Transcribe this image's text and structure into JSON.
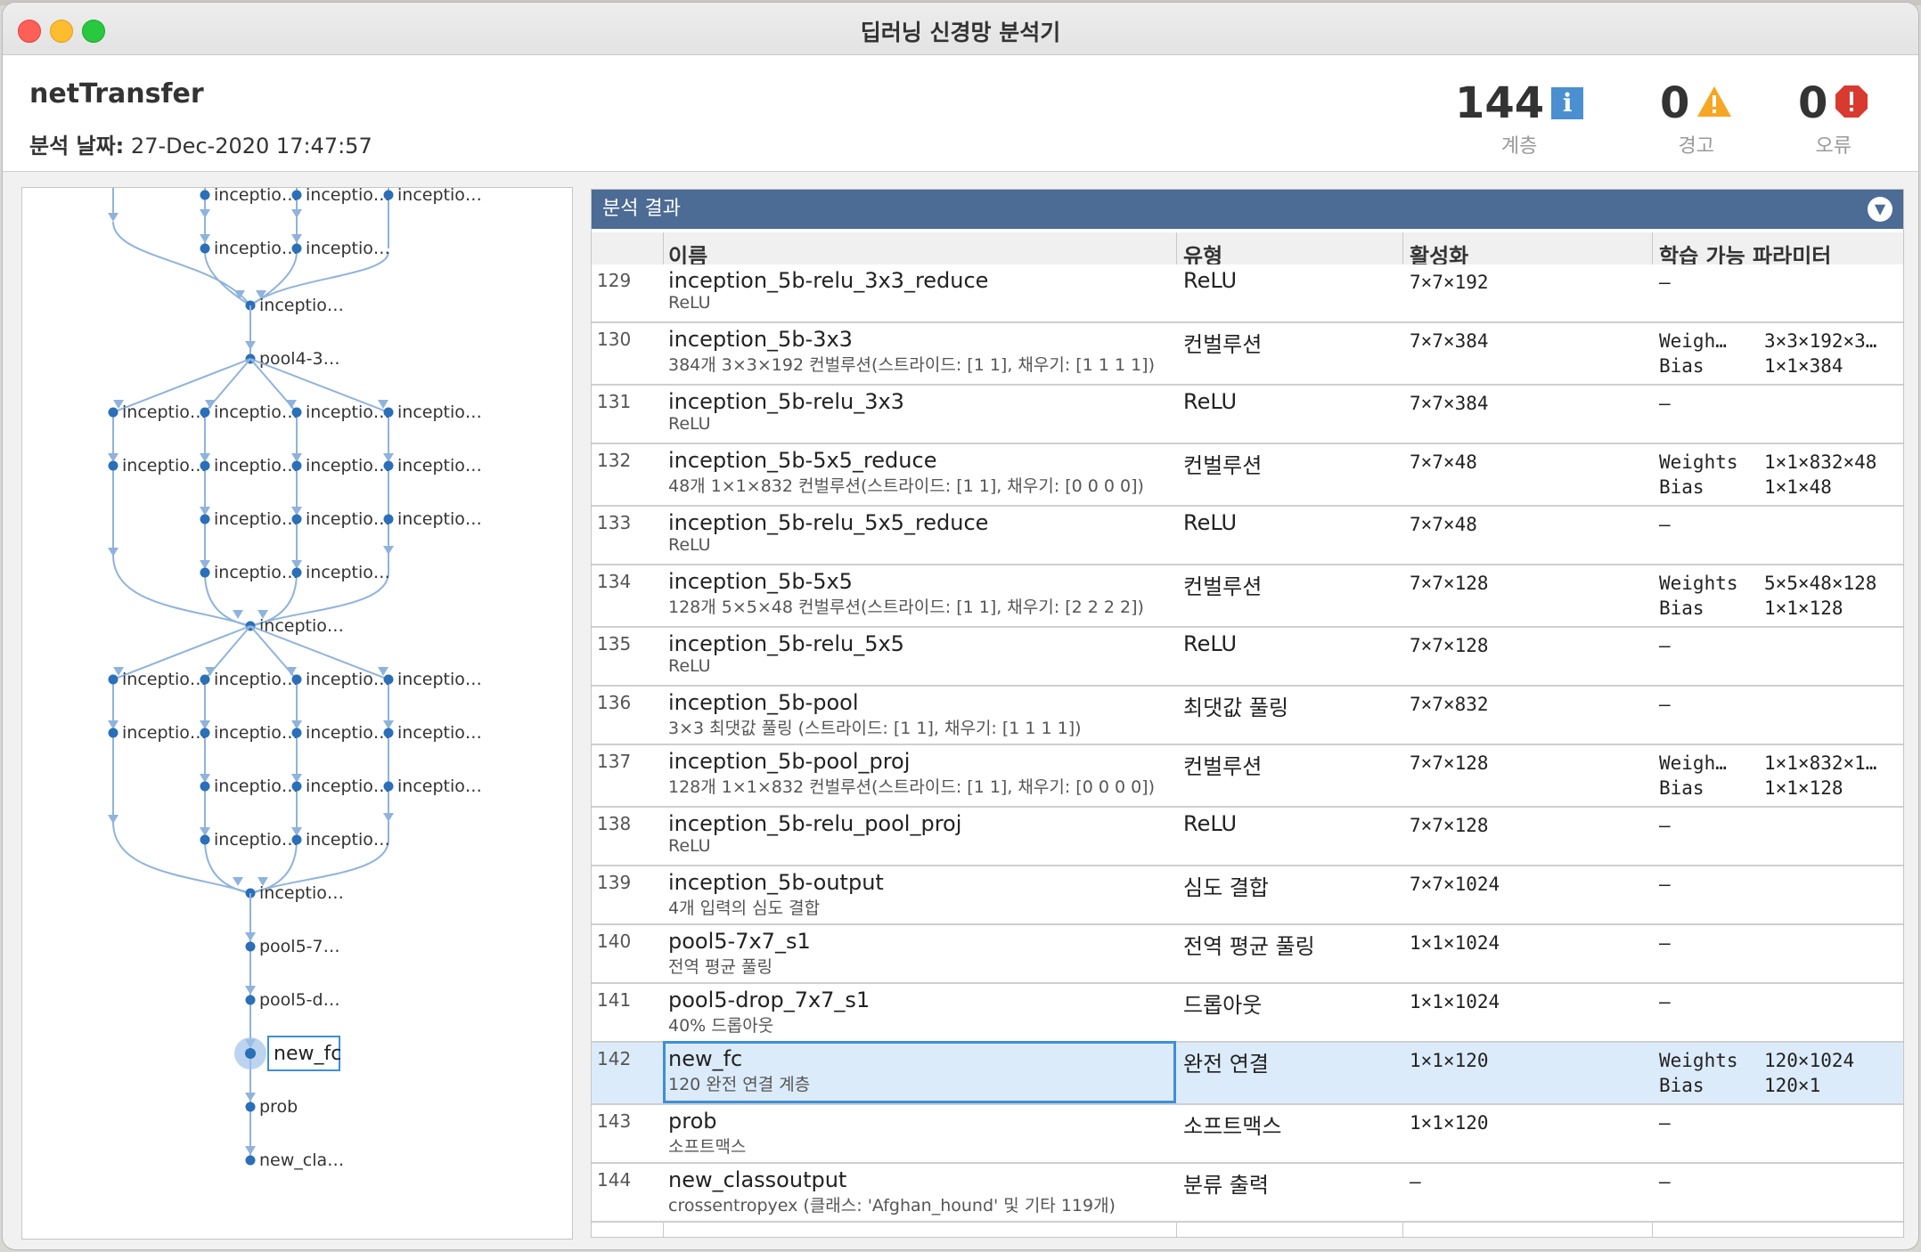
{
  "window": {
    "title": "딥러닝 신경망 분석기"
  },
  "header": {
    "network_name": "netTransfer",
    "date_label": "분석 날짜:",
    "date_value": "27-Dec-2020 17:47:57",
    "layers_count": "144",
    "layers_label": "계층",
    "warnings_count": "0",
    "warnings_label": "경고",
    "errors_count": "0",
    "errors_label": "오류"
  },
  "colors": {
    "accent_bar": "#4c6b95",
    "selection_bg": "#dcebfa",
    "selection_border": "#3d8fd8",
    "node": "#2a6fb8",
    "edge": "#8fb3dc"
  },
  "results": {
    "title": "분석 결과",
    "columns": {
      "name": "이름",
      "type": "유형",
      "activations": "활성화",
      "learnables": "학습 가능 파라미터"
    },
    "rows": [
      {
        "index": "129",
        "name": "inception_5b-relu_3x3_reduce",
        "description": "ReLU",
        "type": "ReLU",
        "activation": "7×7×192",
        "params": [
          {
            "label": "–",
            "value": ""
          }
        ]
      },
      {
        "index": "130",
        "name": "inception_5b-3x3",
        "description": "384개 3×3×192 컨벌루션(스트라이드: [1 1], 채우기: [1 1 1 1])",
        "type": "컨벌루션",
        "activation": "7×7×384",
        "params": [
          {
            "label": "Weigh…",
            "value": "3×3×192×3…"
          },
          {
            "label": "Bias",
            "value": "1×1×384"
          }
        ]
      },
      {
        "index": "131",
        "name": "inception_5b-relu_3x3",
        "description": "ReLU",
        "type": "ReLU",
        "activation": "7×7×384",
        "params": [
          {
            "label": "–",
            "value": ""
          }
        ]
      },
      {
        "index": "132",
        "name": "inception_5b-5x5_reduce",
        "description": "48개 1×1×832 컨벌루션(스트라이드: [1 1], 채우기: [0 0 0 0])",
        "type": "컨벌루션",
        "activation": "7×7×48",
        "params": [
          {
            "label": "Weights",
            "value": "1×1×832×48"
          },
          {
            "label": "Bias",
            "value": "1×1×48"
          }
        ]
      },
      {
        "index": "133",
        "name": "inception_5b-relu_5x5_reduce",
        "description": "ReLU",
        "type": "ReLU",
        "activation": "7×7×48",
        "params": [
          {
            "label": "–",
            "value": ""
          }
        ]
      },
      {
        "index": "134",
        "name": "inception_5b-5x5",
        "description": "128개 5×5×48 컨벌루션(스트라이드: [1 1], 채우기: [2 2 2 2])",
        "type": "컨벌루션",
        "activation": "7×7×128",
        "params": [
          {
            "label": "Weights",
            "value": "5×5×48×128"
          },
          {
            "label": "Bias",
            "value": "1×1×128"
          }
        ]
      },
      {
        "index": "135",
        "name": "inception_5b-relu_5x5",
        "description": "ReLU",
        "type": "ReLU",
        "activation": "7×7×128",
        "params": [
          {
            "label": "–",
            "value": ""
          }
        ]
      },
      {
        "index": "136",
        "name": "inception_5b-pool",
        "description": "3×3 최댓값 풀링 (스트라이드: [1 1], 채우기: [1 1 1 1])",
        "type": "최댓값 풀링",
        "activation": "7×7×832",
        "params": [
          {
            "label": "–",
            "value": ""
          }
        ]
      },
      {
        "index": "137",
        "name": "inception_5b-pool_proj",
        "description": "128개 1×1×832 컨벌루션(스트라이드: [1 1], 채우기: [0 0 0 0])",
        "type": "컨벌루션",
        "activation": "7×7×128",
        "params": [
          {
            "label": "Weigh…",
            "value": "1×1×832×1…"
          },
          {
            "label": "Bias",
            "value": "1×1×128"
          }
        ]
      },
      {
        "index": "138",
        "name": "inception_5b-relu_pool_proj",
        "description": "ReLU",
        "type": "ReLU",
        "activation": "7×7×128",
        "params": [
          {
            "label": "–",
            "value": ""
          }
        ]
      },
      {
        "index": "139",
        "name": "inception_5b-output",
        "description": "4개 입력의 심도 결합",
        "type": "심도 결합",
        "activation": "7×7×1024",
        "params": [
          {
            "label": "–",
            "value": ""
          }
        ]
      },
      {
        "index": "140",
        "name": "pool5-7x7_s1",
        "description": "전역 평균 풀링",
        "type": "전역 평균 풀링",
        "activation": "1×1×1024",
        "params": [
          {
            "label": "–",
            "value": ""
          }
        ]
      },
      {
        "index": "141",
        "name": "pool5-drop_7x7_s1",
        "description": "40% 드롭아웃",
        "type": "드롭아웃",
        "activation": "1×1×1024",
        "params": [
          {
            "label": "–",
            "value": ""
          }
        ]
      },
      {
        "index": "142",
        "name": "new_fc",
        "description": "120 완전 연결 계층",
        "type": "완전 연결",
        "activation": "1×1×120",
        "params": [
          {
            "label": "Weights",
            "value": "120×1024"
          },
          {
            "label": "Bias",
            "value": "120×1"
          }
        ],
        "selected": true
      },
      {
        "index": "143",
        "name": "prob",
        "description": "소프트맥스",
        "type": "소프트맥스",
        "activation": "1×1×120",
        "params": [
          {
            "label": "–",
            "value": ""
          }
        ]
      },
      {
        "index": "144",
        "name": "new_classoutput",
        "description": "crossentropyex (클래스: 'Afghan_hound' 및 기타 119개)",
        "type": "분류 출력",
        "activation": "–",
        "params": [
          {
            "label": "–",
            "value": ""
          }
        ]
      }
    ]
  },
  "graph": {
    "labels": {
      "inception": "inceptio…",
      "inception_mid": "inceptio…",
      "pool4": "pool4-3…",
      "pool5_7": "pool5-7…",
      "pool5_d": "pool5-d…",
      "new_fc": "new_fc",
      "prob": "prob",
      "new_class": "new_cla…"
    }
  }
}
